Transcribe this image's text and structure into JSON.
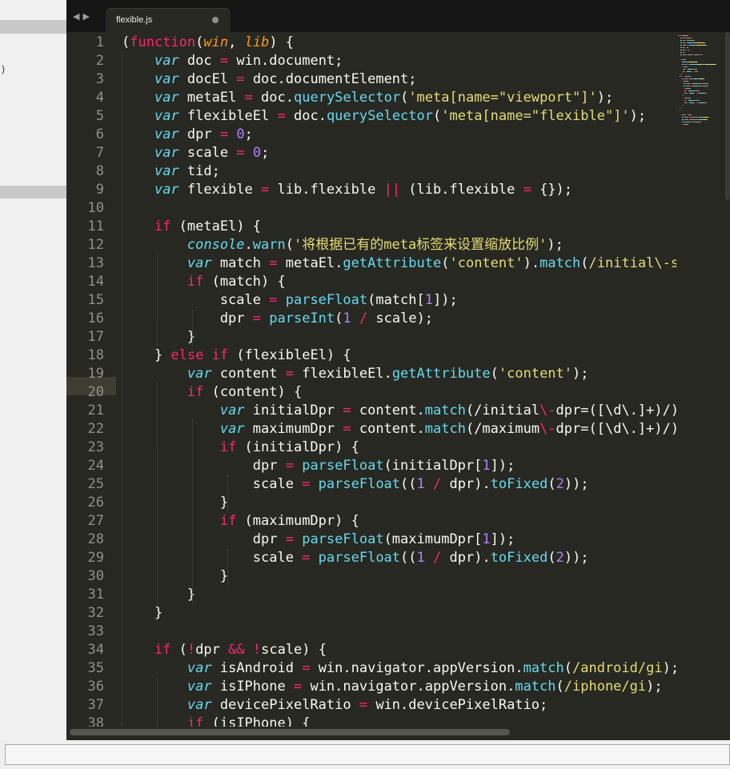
{
  "left_panel": {
    "fragment": ")"
  },
  "tab": {
    "filename": "flexible.js"
  },
  "nav": {
    "back": "◀",
    "forward": "▶"
  },
  "editor": {
    "current_line": 18,
    "lines": [
      [
        [
          "p",
          "("
        ],
        [
          "k",
          "function"
        ],
        [
          "p",
          "("
        ],
        [
          "pa",
          "win"
        ],
        [
          "p",
          ", "
        ],
        [
          "pa",
          "lib"
        ],
        [
          "p",
          ") {"
        ]
      ],
      [
        [
          "p",
          "    "
        ],
        [
          "v",
          "var"
        ],
        [
          "p",
          " doc "
        ],
        [
          "k",
          "="
        ],
        [
          "p",
          " win.document;"
        ]
      ],
      [
        [
          "p",
          "    "
        ],
        [
          "v",
          "var"
        ],
        [
          "p",
          " docEl "
        ],
        [
          "k",
          "="
        ],
        [
          "p",
          " doc.documentElement;"
        ]
      ],
      [
        [
          "p",
          "    "
        ],
        [
          "v",
          "var"
        ],
        [
          "p",
          " metaEl "
        ],
        [
          "k",
          "="
        ],
        [
          "p",
          " doc."
        ],
        [
          "f",
          "querySelector"
        ],
        [
          "p",
          "("
        ],
        [
          "s",
          "'meta[name=\"viewport\"]'"
        ],
        [
          "p",
          ");"
        ]
      ],
      [
        [
          "p",
          "    "
        ],
        [
          "v",
          "var"
        ],
        [
          "p",
          " flexibleEl "
        ],
        [
          "k",
          "="
        ],
        [
          "p",
          " doc."
        ],
        [
          "f",
          "querySelector"
        ],
        [
          "p",
          "("
        ],
        [
          "s",
          "'meta[name=\"flexible\"]'"
        ],
        [
          "p",
          ");"
        ]
      ],
      [
        [
          "p",
          "    "
        ],
        [
          "v",
          "var"
        ],
        [
          "p",
          " dpr "
        ],
        [
          "k",
          "="
        ],
        [
          "p",
          " "
        ],
        [
          "n",
          "0"
        ],
        [
          "p",
          ";"
        ]
      ],
      [
        [
          "p",
          "    "
        ],
        [
          "v",
          "var"
        ],
        [
          "p",
          " scale "
        ],
        [
          "k",
          "="
        ],
        [
          "p",
          " "
        ],
        [
          "n",
          "0"
        ],
        [
          "p",
          ";"
        ]
      ],
      [
        [
          "p",
          "    "
        ],
        [
          "v",
          "var"
        ],
        [
          "p",
          " tid;"
        ]
      ],
      [
        [
          "p",
          "    "
        ],
        [
          "v",
          "var"
        ],
        [
          "p",
          " flexible "
        ],
        [
          "k",
          "="
        ],
        [
          "p",
          " lib.flexible "
        ],
        [
          "k",
          "||"
        ],
        [
          "p",
          " (lib.flexible "
        ],
        [
          "k",
          "="
        ],
        [
          "p",
          " {});"
        ]
      ],
      [],
      [
        [
          "p",
          "    "
        ],
        [
          "k",
          "if"
        ],
        [
          "p",
          " (metaEl) {"
        ]
      ],
      [
        [
          "p",
          "        "
        ],
        [
          "v",
          "console"
        ],
        [
          "p",
          "."
        ],
        [
          "f",
          "warn"
        ],
        [
          "p",
          "("
        ],
        [
          "s",
          "'将根据已有的meta标签来设置缩放比例'"
        ],
        [
          "p",
          ");"
        ]
      ],
      [
        [
          "p",
          "        "
        ],
        [
          "v",
          "var"
        ],
        [
          "p",
          " match "
        ],
        [
          "k",
          "="
        ],
        [
          "p",
          " metaEl."
        ],
        [
          "f",
          "getAttribute"
        ],
        [
          "p",
          "("
        ],
        [
          "s",
          "'content'"
        ],
        [
          "p",
          ")."
        ],
        [
          "f",
          "match"
        ],
        [
          "p",
          "("
        ],
        [
          "s",
          "/initial\\-scale=([\\d\\.]+)/"
        ],
        [
          "p",
          ");"
        ]
      ],
      [
        [
          "p",
          "        "
        ],
        [
          "k",
          "if"
        ],
        [
          "p",
          " (match) {"
        ]
      ],
      [
        [
          "p",
          "            scale "
        ],
        [
          "k",
          "="
        ],
        [
          "p",
          " "
        ],
        [
          "f",
          "parseFloat"
        ],
        [
          "p",
          "(match["
        ],
        [
          "n",
          "1"
        ],
        [
          "p",
          "]);"
        ]
      ],
      [
        [
          "p",
          "            dpr "
        ],
        [
          "k",
          "="
        ],
        [
          "p",
          " "
        ],
        [
          "f",
          "parseInt"
        ],
        [
          "p",
          "("
        ],
        [
          "n",
          "1"
        ],
        [
          "p",
          " "
        ],
        [
          "k",
          "/"
        ],
        [
          "p",
          " scale);"
        ]
      ],
      [
        [
          "p",
          "        }"
        ]
      ],
      [
        [
          "p",
          "    } "
        ],
        [
          "k",
          "else"
        ],
        [
          "p",
          " "
        ],
        [
          "k",
          "if"
        ],
        [
          "p",
          " (flexibleEl) {"
        ]
      ],
      [
        [
          "p",
          "        "
        ],
        [
          "v",
          "var"
        ],
        [
          "p",
          " content "
        ],
        [
          "k",
          "="
        ],
        [
          "p",
          " flexibleEl."
        ],
        [
          "f",
          "getAttribute"
        ],
        [
          "p",
          "("
        ],
        [
          "s",
          "'content'"
        ],
        [
          "p",
          ");"
        ]
      ],
      [
        [
          "p",
          "        "
        ],
        [
          "k",
          "if"
        ],
        [
          "p",
          " (content) {"
        ]
      ],
      [
        [
          "p",
          "            "
        ],
        [
          "v",
          "var"
        ],
        [
          "p",
          " initialDpr "
        ],
        [
          "k",
          "="
        ],
        [
          "p",
          " content."
        ],
        [
          "f",
          "match"
        ],
        [
          "p",
          "(/initial"
        ],
        [
          "k",
          "\\-"
        ],
        [
          "p",
          "dpr=([\\d\\.]+)/);"
        ]
      ],
      [
        [
          "p",
          "            "
        ],
        [
          "v",
          "var"
        ],
        [
          "p",
          " maximumDpr "
        ],
        [
          "k",
          "="
        ],
        [
          "p",
          " content."
        ],
        [
          "f",
          "match"
        ],
        [
          "p",
          "(/maximum"
        ],
        [
          "k",
          "\\-"
        ],
        [
          "p",
          "dpr=([\\d\\.]+)/);"
        ]
      ],
      [
        [
          "p",
          "            "
        ],
        [
          "k",
          "if"
        ],
        [
          "p",
          " (initialDpr) {"
        ]
      ],
      [
        [
          "p",
          "                dpr "
        ],
        [
          "k",
          "="
        ],
        [
          "p",
          " "
        ],
        [
          "f",
          "parseFloat"
        ],
        [
          "p",
          "(initialDpr["
        ],
        [
          "n",
          "1"
        ],
        [
          "p",
          "]);"
        ]
      ],
      [
        [
          "p",
          "                scale "
        ],
        [
          "k",
          "="
        ],
        [
          "p",
          " "
        ],
        [
          "f",
          "parseFloat"
        ],
        [
          "p",
          "(("
        ],
        [
          "n",
          "1"
        ],
        [
          "p",
          " "
        ],
        [
          "k",
          "/"
        ],
        [
          "p",
          " dpr)."
        ],
        [
          "f",
          "toFixed"
        ],
        [
          "p",
          "("
        ],
        [
          "n",
          "2"
        ],
        [
          "p",
          "));"
        ]
      ],
      [
        [
          "p",
          "            }"
        ]
      ],
      [
        [
          "p",
          "            "
        ],
        [
          "k",
          "if"
        ],
        [
          "p",
          " (maximumDpr) {"
        ]
      ],
      [
        [
          "p",
          "                dpr "
        ],
        [
          "k",
          "="
        ],
        [
          "p",
          " "
        ],
        [
          "f",
          "parseFloat"
        ],
        [
          "p",
          "(maximumDpr["
        ],
        [
          "n",
          "1"
        ],
        [
          "p",
          "]);"
        ]
      ],
      [
        [
          "p",
          "                scale "
        ],
        [
          "k",
          "="
        ],
        [
          "p",
          " "
        ],
        [
          "f",
          "parseFloat"
        ],
        [
          "p",
          "(("
        ],
        [
          "n",
          "1"
        ],
        [
          "p",
          " "
        ],
        [
          "k",
          "/"
        ],
        [
          "p",
          " dpr)."
        ],
        [
          "f",
          "toFixed"
        ],
        [
          "p",
          "("
        ],
        [
          "n",
          "2"
        ],
        [
          "p",
          "));"
        ]
      ],
      [
        [
          "p",
          "            }"
        ]
      ],
      [
        [
          "p",
          "        }"
        ]
      ],
      [
        [
          "p",
          "    }"
        ]
      ],
      [],
      [
        [
          "p",
          "    "
        ],
        [
          "k",
          "if"
        ],
        [
          "p",
          " ("
        ],
        [
          "k",
          "!"
        ],
        [
          "p",
          "dpr "
        ],
        [
          "k",
          "&&"
        ],
        [
          "p",
          " "
        ],
        [
          "k",
          "!"
        ],
        [
          "p",
          "scale) {"
        ]
      ],
      [
        [
          "p",
          "        "
        ],
        [
          "v",
          "var"
        ],
        [
          "p",
          " isAndroid "
        ],
        [
          "k",
          "="
        ],
        [
          "p",
          " win.navigator.appVersion."
        ],
        [
          "f",
          "match"
        ],
        [
          "p",
          "("
        ],
        [
          "s",
          "/android/gi"
        ],
        [
          "p",
          ");"
        ]
      ],
      [
        [
          "p",
          "        "
        ],
        [
          "v",
          "var"
        ],
        [
          "p",
          " isIPhone "
        ],
        [
          "k",
          "="
        ],
        [
          "p",
          " win.navigator.appVersion."
        ],
        [
          "f",
          "match"
        ],
        [
          "p",
          "("
        ],
        [
          "s",
          "/iphone/gi"
        ],
        [
          "p",
          ");"
        ]
      ],
      [
        [
          "p",
          "        "
        ],
        [
          "v",
          "var"
        ],
        [
          "p",
          " devicePixelRatio "
        ],
        [
          "k",
          "="
        ],
        [
          "p",
          " win.devicePixelRatio;"
        ]
      ],
      [
        [
          "p",
          "        "
        ],
        [
          "k",
          "if"
        ],
        [
          "p",
          " (isIPhone) {"
        ]
      ]
    ]
  },
  "colors": {
    "background": "#272822",
    "keyword": "#f92672",
    "function": "#66d9ef",
    "string": "#e6db74",
    "number": "#ae81ff",
    "parameter": "#fd971f",
    "plain": "#f8f8f2",
    "line_number": "#8f908a"
  }
}
